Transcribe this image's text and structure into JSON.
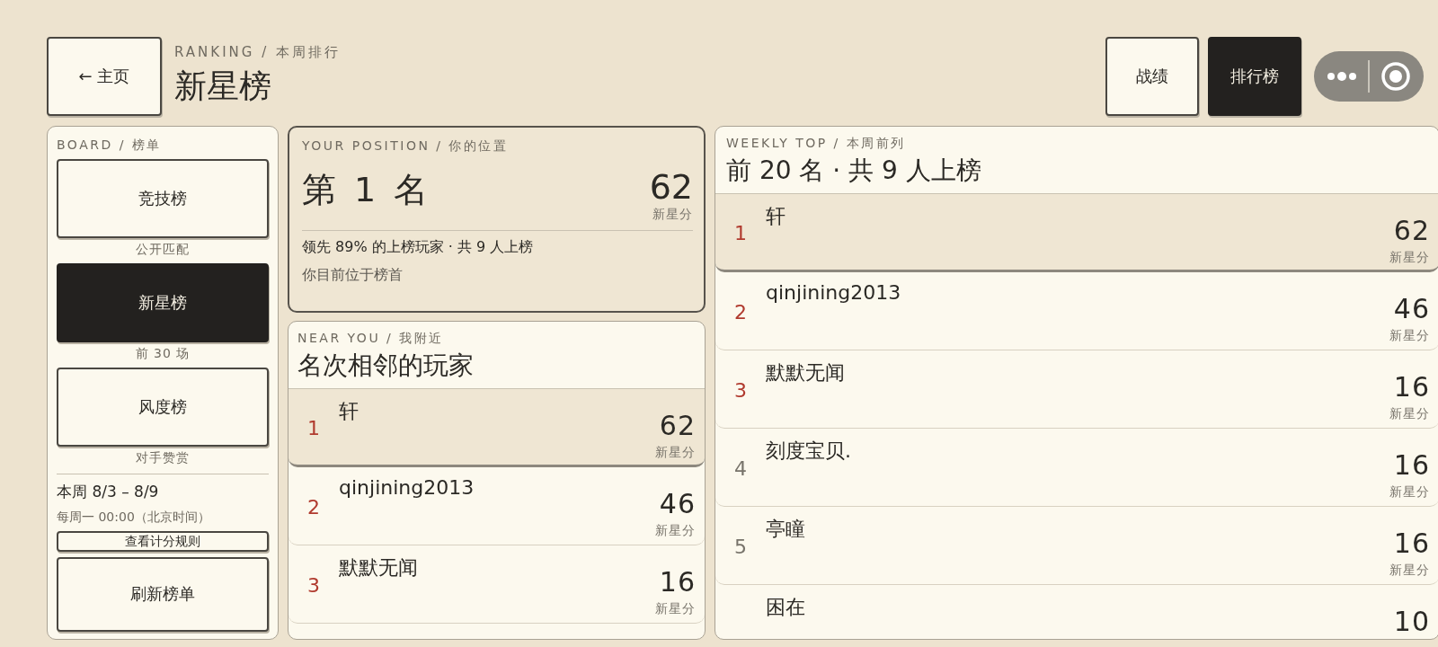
{
  "header": {
    "back_button": "← 主页",
    "eyebrow": "RANKING / 本周排行",
    "title": "新星榜",
    "nav": [
      {
        "label": "战绩",
        "selected": false
      },
      {
        "label": "排行榜",
        "selected": true
      }
    ]
  },
  "board": {
    "label": "BOARD / 榜单",
    "tabs": [
      {
        "label": "竞技榜",
        "caption": "公开匹配",
        "selected": false
      },
      {
        "label": "新星榜",
        "caption": "前 30 场",
        "selected": true
      },
      {
        "label": "风度榜",
        "caption": "对手赞赏",
        "selected": false
      }
    ],
    "week": "本周 8/3 – 8/9",
    "reset": "每周一 00:00（北京时间）",
    "rules_button": "查看计分规则",
    "refresh_button": "刷新榜单"
  },
  "position": {
    "label": "YOUR POSITION / 你的位置",
    "rank": "第 1 名",
    "score": "62",
    "unit": "新星分",
    "summary": "领先 89% 的上榜玩家 · 共 9 人上榜",
    "note": "你目前位于榜首"
  },
  "near": {
    "label": "NEAR YOU / 我附近",
    "title": "名次相邻的玩家",
    "rows": [
      {
        "rank": "1",
        "kind": "podium",
        "name": "轩",
        "score": "62",
        "unit": "新星分",
        "selected": true
      },
      {
        "rank": "2",
        "kind": "podium",
        "name": "qinjining2013",
        "score": "46",
        "unit": "新星分",
        "selected": false
      },
      {
        "rank": "3",
        "kind": "podium",
        "name": "默默无闻",
        "score": "16",
        "unit": "新星分",
        "selected": false
      }
    ]
  },
  "weekly": {
    "label": "WEEKLY TOP / 本周前列",
    "title": "前 20 名 · 共 9 人上榜",
    "rows": [
      {
        "rank": "1",
        "kind": "podium",
        "name": "轩",
        "score": "62",
        "unit": "新星分",
        "selected": true
      },
      {
        "rank": "2",
        "kind": "podium",
        "name": "qinjining2013",
        "score": "46",
        "unit": "新星分",
        "selected": false
      },
      {
        "rank": "3",
        "kind": "podium",
        "name": "默默无闻",
        "score": "16",
        "unit": "新星分",
        "selected": false
      },
      {
        "rank": "4",
        "kind": "regular",
        "name": "刻度宝贝.",
        "score": "16",
        "unit": "新星分",
        "selected": false
      },
      {
        "rank": "5",
        "kind": "regular",
        "name": "亭瞳",
        "score": "16",
        "unit": "新星分",
        "selected": false
      },
      {
        "name": "困在",
        "score": "10",
        "selected": false
      }
    ]
  }
}
